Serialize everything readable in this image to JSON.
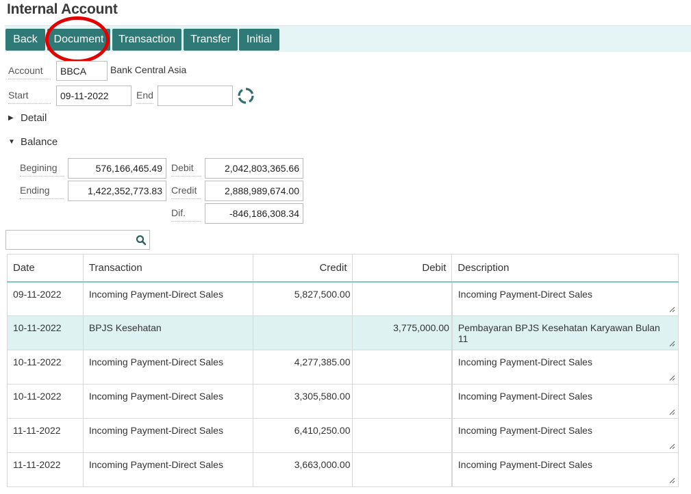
{
  "title": "Internal Account",
  "toolbar": {
    "back": "Back",
    "document": "Document",
    "transaction": "Transaction",
    "transfer": "Transfer",
    "initial": "Initial"
  },
  "account": {
    "label": "Account",
    "code": "BBCA",
    "name": "Bank Central Asia"
  },
  "period": {
    "start_label": "Start",
    "start_value": "09-11-2022",
    "end_label": "End",
    "end_value": ""
  },
  "sections": {
    "detail": "Detail",
    "balance": "Balance"
  },
  "balance": {
    "begining_label": "Begining",
    "begining_value": "576,166,465.49",
    "ending_label": "Ending",
    "ending_value": "1,422,352,773.83",
    "debit_label": "Debit",
    "debit_value": "2,042,803,365.66",
    "credit_label": "Credit",
    "credit_value": "2,888,989,674.00",
    "dif_label": "Dif.",
    "dif_value": "-846,186,308.34"
  },
  "search": {
    "placeholder": ""
  },
  "table": {
    "columns": [
      "Date",
      "Transaction",
      "Credit",
      "Debit",
      "Description"
    ],
    "rows": [
      {
        "date": "09-11-2022",
        "transaction": "Incoming Payment-Direct Sales",
        "credit": "5,827,500.00",
        "debit": "",
        "description": "Incoming Payment-Direct Sales"
      },
      {
        "date": "10-11-2022",
        "transaction": "BPJS Kesehatan",
        "credit": "",
        "debit": "3,775,000.00",
        "description": "Pembayaran BPJS Kesehatan Karyawan Bulan 11"
      },
      {
        "date": "10-11-2022",
        "transaction": "Incoming Payment-Direct Sales",
        "credit": "4,277,385.00",
        "debit": "",
        "description": "Incoming Payment-Direct Sales"
      },
      {
        "date": "10-11-2022",
        "transaction": "Incoming Payment-Direct Sales",
        "credit": "3,305,580.00",
        "debit": "",
        "description": "Incoming Payment-Direct Sales"
      },
      {
        "date": "11-11-2022",
        "transaction": "Incoming Payment-Direct Sales",
        "credit": "6,410,250.00",
        "debit": "",
        "description": "Incoming Payment-Direct Sales"
      },
      {
        "date": "11-11-2022",
        "transaction": "Incoming Payment-Direct Sales",
        "credit": "3,663,000.00",
        "debit": "",
        "description": "Incoming Payment-Direct Sales"
      }
    ]
  },
  "colors": {
    "toolbar_bg": "#e5f4f4",
    "button": "#2f7a77",
    "selected_row": "#dff2f2",
    "header_rule": "#7cc8c5",
    "highlight": "#e00000"
  }
}
